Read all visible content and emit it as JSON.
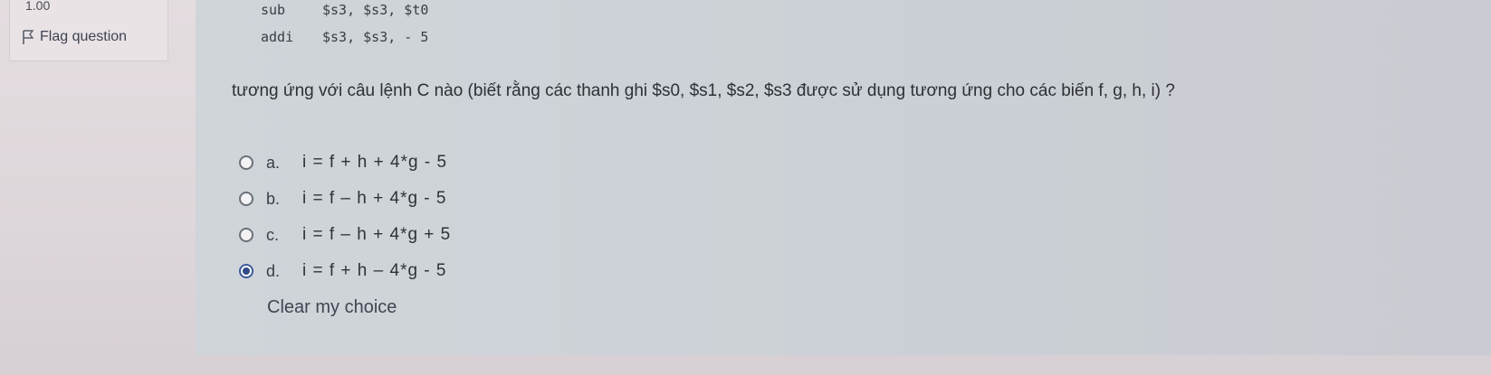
{
  "info": {
    "grade_value": "1.00",
    "flag_label": "Flag question",
    "flag_icon": "flag-icon"
  },
  "code": [
    {
      "op": "sub",
      "args": "$s3, $s3, $t0"
    },
    {
      "op": "addi",
      "args": "$s3, $s3, - 5"
    }
  ],
  "question_text": "tương ứng với câu lệnh C nào (biết rằng các thanh ghi $s0, $s1, $s2, $s3 được sử dụng tương ứng cho các biến f, g, h, i) ?",
  "answers": [
    {
      "letter": "a.",
      "text": "i = f + h + 4*g - 5",
      "selected": false
    },
    {
      "letter": "b.",
      "text": "i = f – h + 4*g - 5",
      "selected": false
    },
    {
      "letter": "c.",
      "text": "i = f – h + 4*g + 5",
      "selected": false
    },
    {
      "letter": "d.",
      "text": "i = f + h – 4*g - 5",
      "selected": true
    }
  ],
  "clear_choice_label": "Clear my choice",
  "colors": {
    "radio_selected": "#2f4a86",
    "content_bg": "#cfd5d9"
  }
}
